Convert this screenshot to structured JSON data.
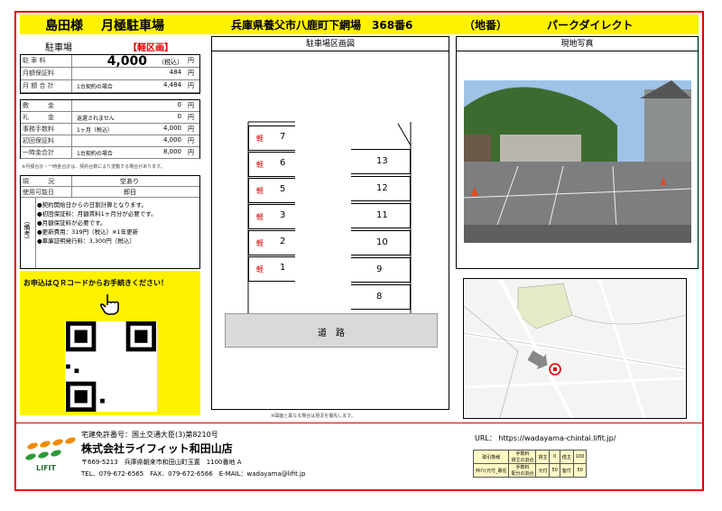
{
  "header": {
    "owner": "島田様",
    "title": "月極駐車場",
    "address": "兵庫県養父市八鹿町下網場　368番6",
    "address_note": "（地番）",
    "name": "パークダイレクト"
  },
  "fees": {
    "heading": "駐車場",
    "badge": "【軽区画】",
    "rows1": [
      {
        "label": "駐 車 料",
        "value": "4,000",
        "note": "（税込）",
        "unit": "円"
      },
      {
        "label": "月額保証料",
        "value": "484",
        "unit": "円"
      },
      {
        "label": "月 額 合 計",
        "note": "1台契約の場合",
        "value": "4,484",
        "unit": "円"
      }
    ],
    "rows2": [
      {
        "label": "敷　　　金",
        "value": "0",
        "unit": "円"
      },
      {
        "label": "礼　　　金",
        "note": "返還されません",
        "value": "0",
        "unit": "円"
      },
      {
        "label": "事務手数料",
        "note": "1ヶ月（税込）",
        "value": "4,000",
        "unit": "円"
      },
      {
        "label": "初回保証料",
        "value": "4,000",
        "unit": "円"
      },
      {
        "label": "一時金合計",
        "note": "1台契約の場合",
        "value": "8,000",
        "unit": "円"
      }
    ],
    "footnote": "※月額合計・一時金合計は、契約台数により変動する場合があります。",
    "status_label": "現　　　況",
    "status_value": "空あり",
    "available_label": "使用可能日",
    "available_value": "即日",
    "remarks_label": "（備考）",
    "remarks": [
      "●契約開始日からの日割計算となります。",
      "●初回保証料：月額賃料1ヶ月分が必要です。",
      "●月額保証料が必要です。",
      "●更新費用：319円（税込）※1年更新",
      "●車庫証明発行料：3,300円（税込）"
    ],
    "qr_prompt": "お申込はＱＲコードからお手続きください！"
  },
  "map_panel": {
    "title": "駐車場区画図",
    "left_slots": [
      {
        "k": "軽",
        "n": "7"
      },
      {
        "k": "軽",
        "n": "6"
      },
      {
        "k": "軽",
        "n": "5"
      },
      {
        "k": "軽",
        "n": "3"
      },
      {
        "k": "軽",
        "n": "2"
      },
      {
        "k": "軽",
        "n": "1"
      }
    ],
    "right_slots": [
      "13",
      "12",
      "11",
      "10",
      "9",
      "8"
    ],
    "road": "道　路",
    "footnote": "※図面と異なる場合は現況を優先します。"
  },
  "photo_panel": {
    "title": "現地写真"
  },
  "company": {
    "license": "宅建免許番号：国土交通大臣(3)第8210号",
    "name": "株式会社ライフィット和田山店",
    "address": "〒669-5213　兵庫県朝来市和田山町玉置　1100番地 A",
    "contact": "TEL．079-672-6565　FAX．079-672-6566　E-MAIL：wadayama@lifit.jp",
    "logo_text": "LIFIT",
    "url": "URL： https://wadayama-chintai.lifit.jp/"
  },
  "fee_table": {
    "r1": [
      "取引態様",
      "手数料\n貸主の割合",
      "貸主",
      "0",
      "借主",
      "100"
    ],
    "r2": [
      "仲介(元付_專任",
      "手数料\n配分の割合",
      "元付",
      "50",
      "客付",
      "50"
    ]
  },
  "colors": {
    "accent_red": "#e00000",
    "header_yellow": "#fff200",
    "badge_red": "#e00000"
  }
}
